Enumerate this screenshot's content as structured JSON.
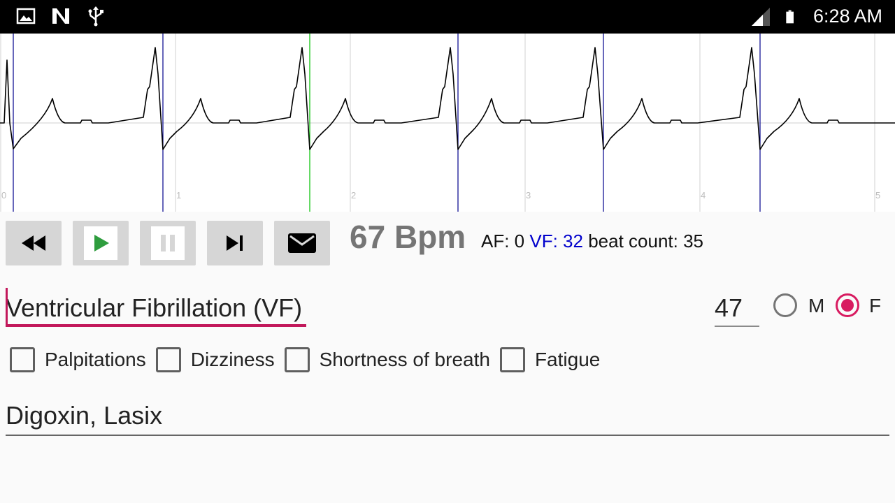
{
  "status_bar": {
    "time": "6:28 AM",
    "left_icons": [
      "image-icon",
      "n-icon",
      "usb-icon"
    ],
    "right_icons": [
      "signal-icon",
      "battery-icon"
    ]
  },
  "ecg": {
    "axis_labels": [
      "0",
      "1",
      "2",
      "3",
      "4",
      "5"
    ],
    "trace_color": "#000000",
    "beat_marker_color": "#00008b",
    "current_marker_color": "#00c000",
    "grid_color": "#d0d0d0"
  },
  "controls": {
    "buttons": [
      {
        "name": "rewind-button",
        "icon": "rewind-icon"
      },
      {
        "name": "play-button",
        "icon": "play-icon"
      },
      {
        "name": "pause-button",
        "icon": "pause-icon"
      },
      {
        "name": "skip-next-button",
        "icon": "skip-next-icon"
      },
      {
        "name": "email-button",
        "icon": "email-icon"
      }
    ],
    "bpm": "67 Bpm",
    "af_label": "AF: 0",
    "vf_label": "VF: 32",
    "beat_count_label": "beat count: 35"
  },
  "form": {
    "diagnosis_value": "Ventricular Fibrillation (VF)",
    "age_value": "47",
    "gender_options": [
      "M",
      "F"
    ],
    "gender_selected": "F",
    "symptoms": [
      {
        "label": "Palpitations",
        "checked": false
      },
      {
        "label": "Dizziness",
        "checked": false
      },
      {
        "label": "Shortness of breath",
        "checked": false
      },
      {
        "label": "Fatigue",
        "checked": false
      }
    ],
    "medications_value": "Digoxin, Lasix"
  },
  "colors": {
    "accent": "#d81b60",
    "bpm_text": "#757575",
    "vf_text": "#0000cc"
  }
}
